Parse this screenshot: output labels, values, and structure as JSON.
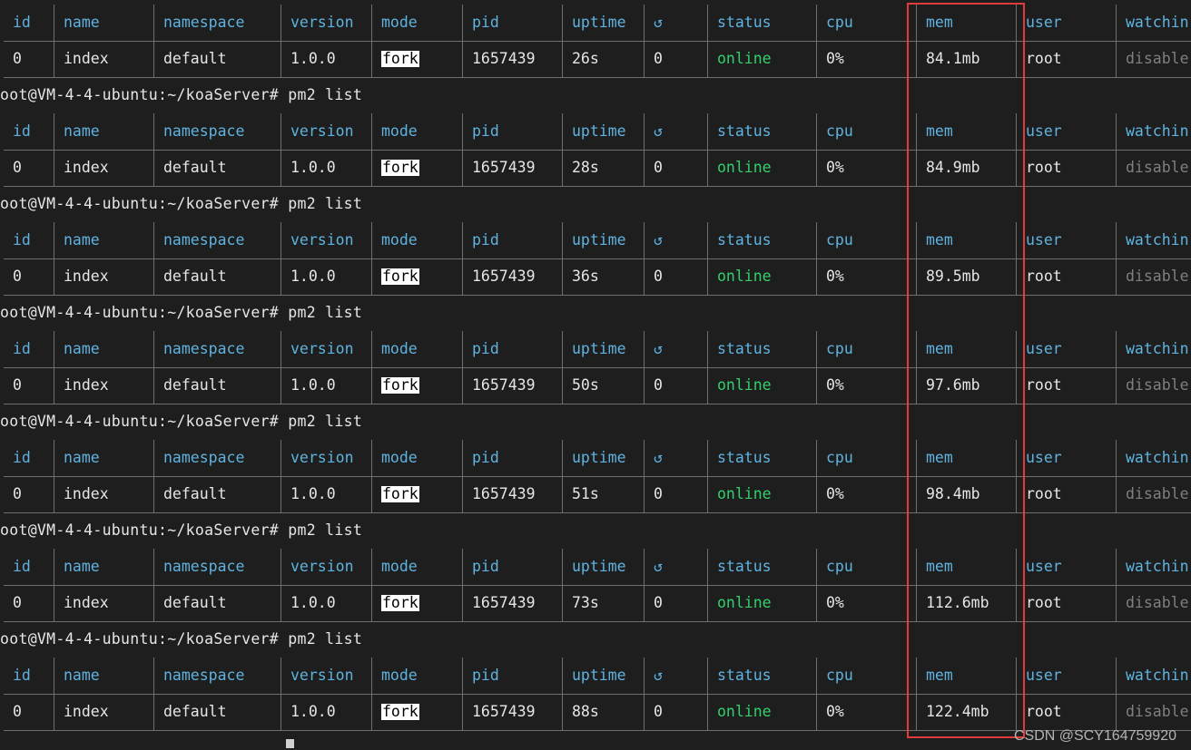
{
  "terminal": {
    "prompt": "oot@VM-4-4-ubuntu:~/koaServer# pm2 list",
    "columns": [
      "id",
      "name",
      "namespace",
      "version",
      "mode",
      "pid",
      "uptime",
      "↺",
      "status",
      "cpu",
      "mem",
      "user",
      "watchin"
    ],
    "tables": [
      {
        "id": "0",
        "name": "index",
        "namespace": "default",
        "version": "1.0.0",
        "mode": "fork",
        "pid": "1657439",
        "uptime": "26s",
        "restarts": "0",
        "status": "online",
        "cpu": "0%",
        "mem": "84.1mb",
        "user": "root",
        "watching": "disable"
      },
      {
        "id": "0",
        "name": "index",
        "namespace": "default",
        "version": "1.0.0",
        "mode": "fork",
        "pid": "1657439",
        "uptime": "28s",
        "restarts": "0",
        "status": "online",
        "cpu": "0%",
        "mem": "84.9mb",
        "user": "root",
        "watching": "disable"
      },
      {
        "id": "0",
        "name": "index",
        "namespace": "default",
        "version": "1.0.0",
        "mode": "fork",
        "pid": "1657439",
        "uptime": "36s",
        "restarts": "0",
        "status": "online",
        "cpu": "0%",
        "mem": "89.5mb",
        "user": "root",
        "watching": "disable"
      },
      {
        "id": "0",
        "name": "index",
        "namespace": "default",
        "version": "1.0.0",
        "mode": "fork",
        "pid": "1657439",
        "uptime": "50s",
        "restarts": "0",
        "status": "online",
        "cpu": "0%",
        "mem": "97.6mb",
        "user": "root",
        "watching": "disable"
      },
      {
        "id": "0",
        "name": "index",
        "namespace": "default",
        "version": "1.0.0",
        "mode": "fork",
        "pid": "1657439",
        "uptime": "51s",
        "restarts": "0",
        "status": "online",
        "cpu": "0%",
        "mem": "98.4mb",
        "user": "root",
        "watching": "disable"
      },
      {
        "id": "0",
        "name": "index",
        "namespace": "default",
        "version": "1.0.0",
        "mode": "fork",
        "pid": "1657439",
        "uptime": "73s",
        "restarts": "0",
        "status": "online",
        "cpu": "0%",
        "mem": "112.6mb",
        "user": "root",
        "watching": "disable"
      },
      {
        "id": "0",
        "name": "index",
        "namespace": "default",
        "version": "1.0.0",
        "mode": "fork",
        "pid": "1657439",
        "uptime": "88s",
        "restarts": "0",
        "status": "online",
        "cpu": "0%",
        "mem": "122.4mb",
        "user": "root",
        "watching": "disable"
      }
    ]
  },
  "annotation": {
    "highlight_color": "#e23b3b",
    "highlighted_column": "mem"
  },
  "watermark": "CSDN @SCY164759920",
  "colors": {
    "background": "#1e1e1e",
    "header_text": "#5fb3e0",
    "cell_text": "#e6e6e6",
    "online": "#2fd16e",
    "disabled": "#7f7f7f",
    "grid": "#6f6f6f"
  }
}
